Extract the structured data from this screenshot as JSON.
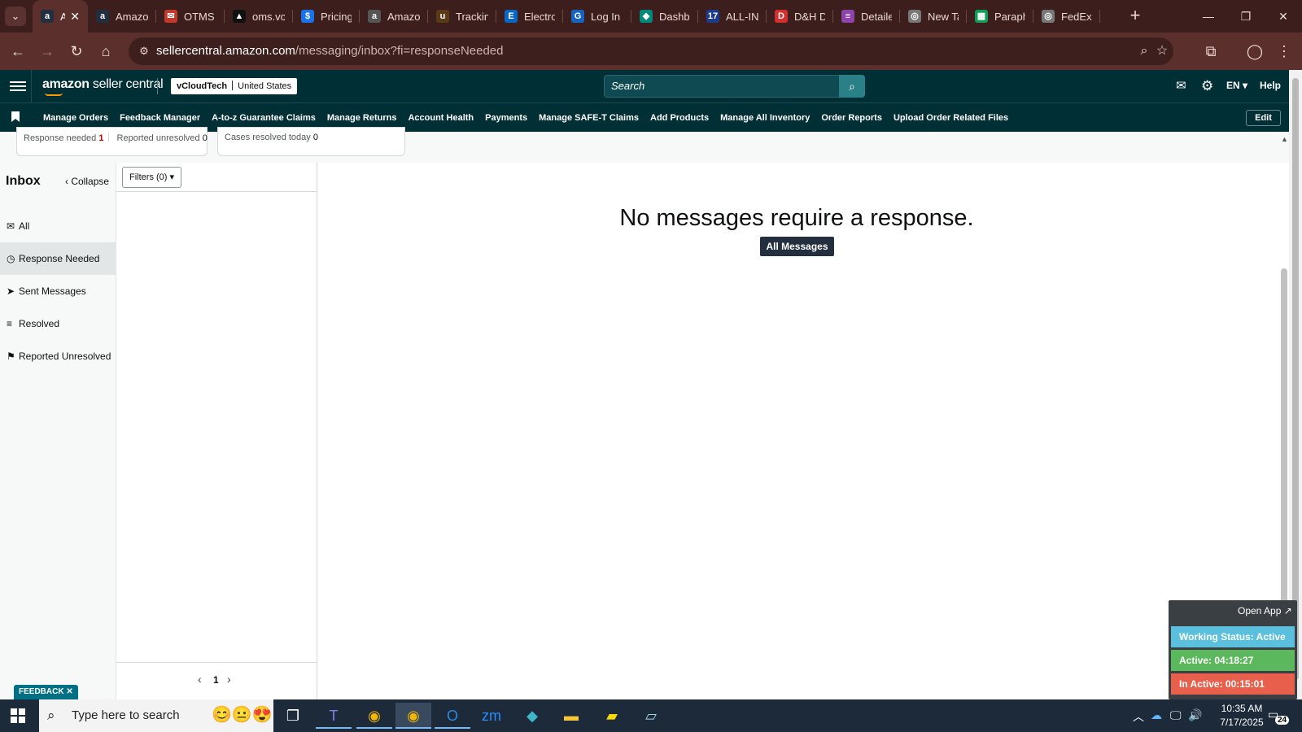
{
  "browser": {
    "tabs": [
      {
        "title": "Ar",
        "favicon": "amazon-icon",
        "color": "#232f3e",
        "glyph": "a",
        "active": true
      },
      {
        "title": "Amazo",
        "favicon": "amazon-icon",
        "color": "#232f3e",
        "glyph": "a"
      },
      {
        "title": "OTMS",
        "favicon": "otms-icon",
        "color": "#c0392b",
        "glyph": "✉"
      },
      {
        "title": "oms.vc",
        "favicon": "oms-icon",
        "color": "#111111",
        "glyph": "▲"
      },
      {
        "title": "Pricing",
        "favicon": "pricing-icon",
        "color": "#1a73e8",
        "glyph": "$"
      },
      {
        "title": "Amazo",
        "favicon": "amazon-icon",
        "color": "#555555",
        "glyph": "a"
      },
      {
        "title": "Trackin",
        "favicon": "ups-icon",
        "color": "#5b3a1a",
        "glyph": "u"
      },
      {
        "title": "Electro",
        "favicon": "ec-icon",
        "color": "#0a66c2",
        "glyph": "E"
      },
      {
        "title": "Log In",
        "favicon": "login-icon",
        "color": "#1565c0",
        "glyph": "G"
      },
      {
        "title": "Dashb",
        "favicon": "dashboard-icon",
        "color": "#00897b",
        "glyph": "◆"
      },
      {
        "title": "ALL-IN",
        "favicon": "seventeen-track-icon",
        "color": "#1e3a8a",
        "glyph": "17"
      },
      {
        "title": "D&H D",
        "favicon": "dh-icon",
        "color": "#d32f2f",
        "glyph": "D"
      },
      {
        "title": "Detaile",
        "favicon": "detailed-icon",
        "color": "#8e44ad",
        "glyph": "≡"
      },
      {
        "title": "New Ta",
        "favicon": "chrome-icon",
        "color": "#777777",
        "glyph": "◎"
      },
      {
        "title": "Paraph",
        "favicon": "sheets-icon",
        "color": "#0f9d58",
        "glyph": "▦"
      },
      {
        "title": "FedEx",
        "favicon": "chrome-icon",
        "color": "#777777",
        "glyph": "◎"
      }
    ],
    "url_host": "sellercentral.amazon.com",
    "url_path": "/messaging/inbox?fi=responseNeeded"
  },
  "header": {
    "brand_bold": "amazon",
    "brand_rest": " seller central",
    "store_name": "vCloudTech",
    "marketplace": "United States",
    "search_placeholder": "Search",
    "language": "EN",
    "help": "Help"
  },
  "nav": {
    "items": [
      "Manage Orders",
      "Feedback Manager",
      "A-to-z Guarantee Claims",
      "Manage Returns",
      "Account Health",
      "Payments",
      "Manage SAFE-T Claims",
      "Add Products",
      "Manage All Inventory",
      "Order Reports",
      "Upload Order Related Files"
    ],
    "edit": "Edit"
  },
  "stats": {
    "response_needed_label": "Response needed",
    "response_needed_value": "1",
    "reported_unresolved_label": "Reported unresolved",
    "reported_unresolved_value": "0",
    "cases_resolved_label": "Cases resolved today",
    "cases_resolved_value": "0"
  },
  "inbox": {
    "title": "Inbox",
    "collapse": "Collapse",
    "items": [
      {
        "label": "All",
        "icon": "mail-icon",
        "glyph": "✉"
      },
      {
        "label": "Response Needed",
        "icon": "clock-icon",
        "glyph": "◷",
        "active": true
      },
      {
        "label": "Sent Messages",
        "icon": "send-icon",
        "glyph": "➤"
      },
      {
        "label": "Resolved",
        "icon": "resolved-list-icon",
        "glyph": "≡"
      },
      {
        "label": "Reported Unresolved",
        "icon": "reported-user-icon",
        "glyph": "⚑"
      }
    ],
    "filters_label": "Filters (0)",
    "page": "1"
  },
  "main": {
    "empty_message": "No messages require a response.",
    "all_messages_button": "All Messages"
  },
  "feedback": "FEEDBACK",
  "tracker": {
    "open_app": "Open App ↗",
    "working_status": "Working Status: Active",
    "active": "Active: 04:18:27",
    "inactive": "In Active: 00:15:01",
    "colors": {
      "status": "#5bc0de",
      "active": "#5cb85c",
      "inactive": "#e8604c"
    }
  },
  "taskbar": {
    "search_placeholder": "Type here to search",
    "time": "10:35 AM",
    "date": "7/17/2025",
    "notification_count": "24"
  }
}
